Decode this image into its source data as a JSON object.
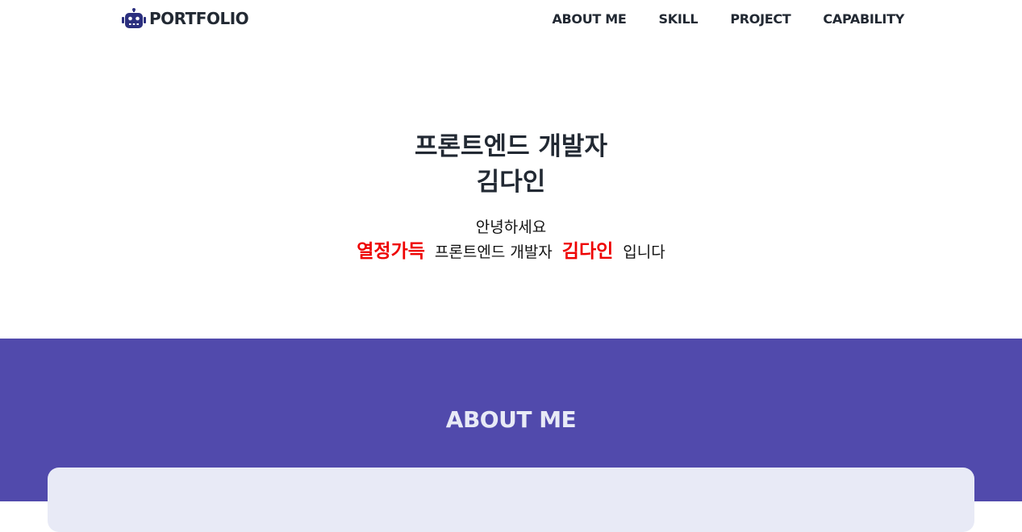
{
  "nav": {
    "logo_icon": "robot-icon",
    "logo_text": "PORTFOLIO",
    "items": [
      {
        "label": "ABOUT ME"
      },
      {
        "label": "SKILL"
      },
      {
        "label": "PROJECT"
      },
      {
        "label": "CAPABILITY"
      }
    ]
  },
  "hero": {
    "title_line1": "프론트엔드 개발자",
    "title_line2": "김다인",
    "greeting": "안녕하세요",
    "intro": {
      "highlight1": "열정가득",
      "text1": "프론트엔드 개발자",
      "highlight2": "김다인",
      "text2": "입니다"
    }
  },
  "about": {
    "title": "ABOUT ME"
  },
  "colors": {
    "text_dark": "#222933",
    "logo_icon": "#2b2f7e",
    "highlight": "#ee0000",
    "about_bg": "#514aac",
    "about_title": "#e8eaf6",
    "card_bg": "#e8eaf6"
  }
}
